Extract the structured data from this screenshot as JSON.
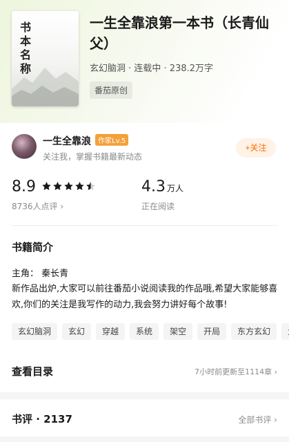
{
  "book": {
    "cover_title": "书本名称",
    "title": "一生全靠浪第一本书（长青仙父）",
    "meta": "玄幻脑洞 · 连载中 · 238.2万字",
    "source_tag": "番茄原创"
  },
  "author": {
    "name": "一生全靠浪",
    "level": "作家Lv.5",
    "subtitle": "关注我，掌握书籍最新动态",
    "follow_label": "+关注"
  },
  "stats": {
    "score": "8.9",
    "rating_stars": 4.5,
    "rating_count": "8736人点评 ›",
    "readers": "4.3",
    "readers_unit": "万人",
    "readers_label": "正在阅读"
  },
  "intro": {
    "title": "书籍简介",
    "protagonist": "主角：  秦长青",
    "synopsis": "新作品出炉,大家可以前往番茄小说阅读我的作品哦,希望大家能够喜欢,你们的关注是我写作的动力,我会努力讲好每个故事!",
    "tags": [
      "玄幻脑洞",
      "玄幻",
      "穿越",
      "系统",
      "架空",
      "开局",
      "东方玄幻",
      "大"
    ]
  },
  "catalog": {
    "title": "查看目录",
    "update": "7小时前更新至1114章 ›"
  },
  "reviews": {
    "title": "书评 · 2137",
    "all_label": "全部书评 ›"
  },
  "colors": {
    "accent": "#ff6a00",
    "star": "#1a1a1a",
    "level_badge": "#f5a03a"
  }
}
